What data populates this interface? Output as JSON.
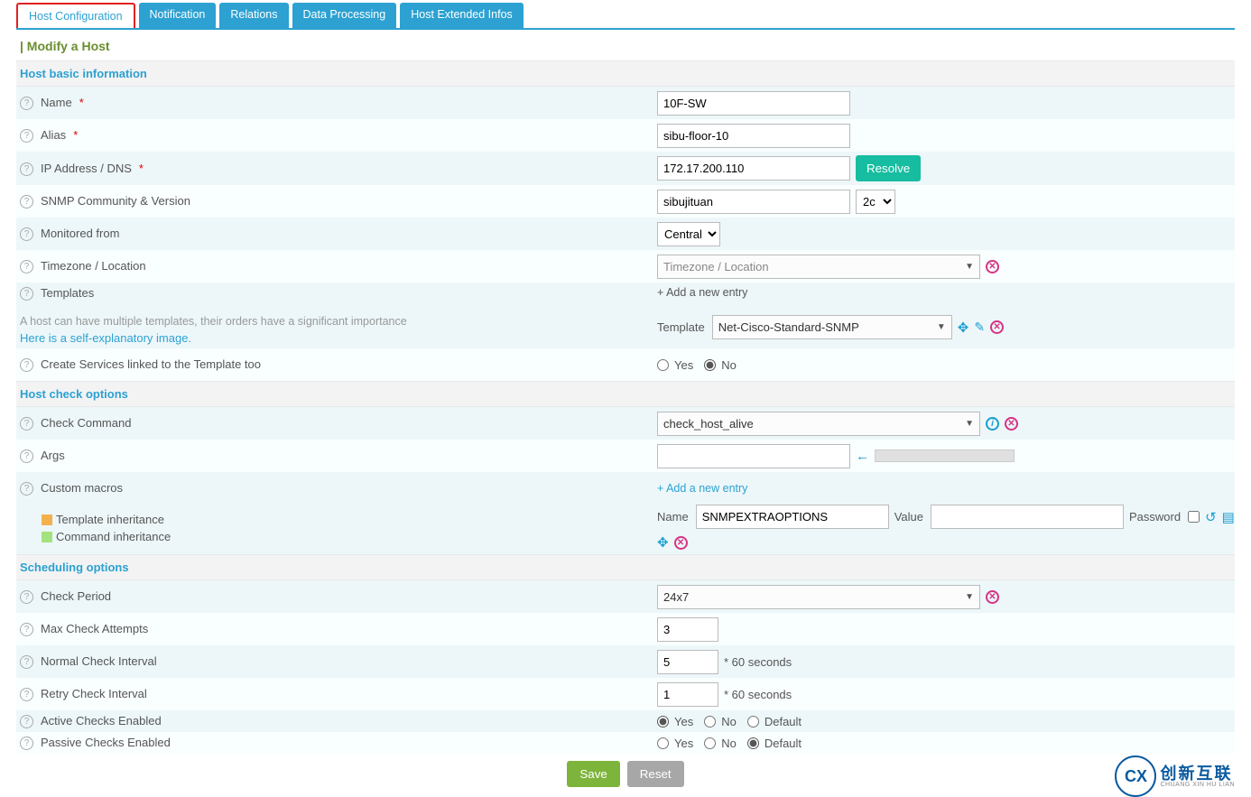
{
  "tabs": {
    "active": "Host Configuration",
    "items": [
      "Host Configuration",
      "Notification",
      "Relations",
      "Data Processing",
      "Host Extended Infos"
    ]
  },
  "page_title": "| Modify a Host",
  "sections": {
    "basic": "Host basic information",
    "check": "Host check options",
    "sched": "Scheduling options"
  },
  "labels": {
    "name": "Name",
    "alias": "Alias",
    "ip": "IP Address / DNS",
    "snmp": "SNMP Community & Version",
    "monitored": "Monitored from",
    "tz": "Timezone / Location",
    "templates": "Templates",
    "tmpl_sub1": "A host can have multiple templates, their orders have a significant importance",
    "tmpl_sub2": "Here is a self-explanatory image.",
    "create_svc": "Create Services linked to the Template too",
    "check_cmd": "Check Command",
    "args": "Args",
    "custom_macros": "Custom macros",
    "legend_tmpl": "Template inheritance",
    "legend_cmd": "Command inheritance",
    "check_period": "Check Period",
    "max_attempts": "Max Check Attempts",
    "normal_int": "Normal Check Interval",
    "retry_int": "Retry Check Interval",
    "active": "Active Checks Enabled",
    "passive": "Passive Checks Enabled",
    "sec60": "* 60 seconds",
    "yes": "Yes",
    "no": "No",
    "default": "Default",
    "add_entry": "+ Add a new entry",
    "template_lbl": "Template",
    "macro_name": "Name",
    "macro_value": "Value",
    "macro_pwd": "Password",
    "tz_placeholder": "Timezone / Location"
  },
  "values": {
    "name": "10F-SW",
    "alias": "sibu-floor-10",
    "ip": "172.17.200.110",
    "snmp_comm": "sibujituan",
    "snmp_ver": "2c",
    "monitored": "Central",
    "tmpl_select": "Net-Cisco-Standard-SNMP",
    "create_svc": "No",
    "check_cmd": "check_host_alive",
    "check_period": "24x7",
    "max_attempts": "3",
    "normal_int": "5",
    "retry_int": "1",
    "active": "Yes",
    "passive": "Default",
    "macro_name": "SNMPEXTRAOPTIONS",
    "macro_value": ""
  },
  "buttons": {
    "resolve": "Resolve",
    "save": "Save",
    "reset": "Reset"
  },
  "logo": {
    "big": "创新互联",
    "small": "CHUANG XIN HU LIAN"
  }
}
